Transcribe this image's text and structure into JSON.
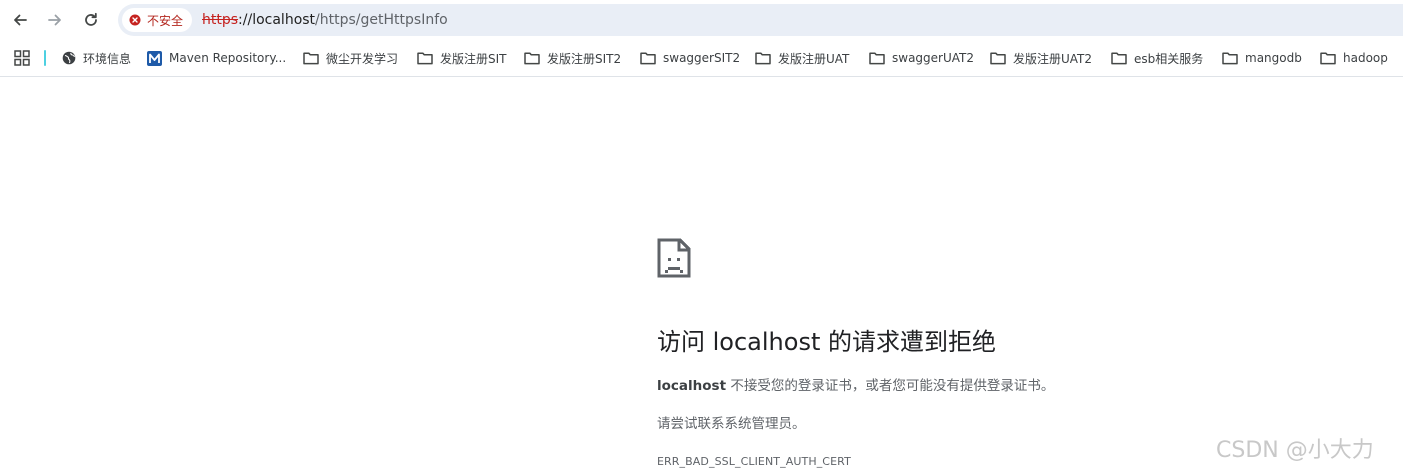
{
  "omnibox": {
    "security_chip": "不安全",
    "url_scheme": "https",
    "url_separator": "://",
    "url_host": "localhost",
    "url_path": "/https/getHttpsInfo"
  },
  "bookmarks": [
    {
      "label": "环境信息",
      "icon": "globe-icon"
    },
    {
      "label": "Maven Repository...",
      "icon": "maven-icon"
    },
    {
      "label": "微尘开发学习",
      "icon": "folder-icon"
    },
    {
      "label": "发版注册SIT",
      "icon": "folder-icon"
    },
    {
      "label": "发版注册SIT2",
      "icon": "folder-icon"
    },
    {
      "label": "swaggerSIT2",
      "icon": "folder-icon"
    },
    {
      "label": "发版注册UAT",
      "icon": "folder-icon"
    },
    {
      "label": "swaggerUAT2",
      "icon": "folder-icon"
    },
    {
      "label": "发版注册UAT2",
      "icon": "folder-icon"
    },
    {
      "label": "esb相关服务",
      "icon": "folder-icon"
    },
    {
      "label": "mangodb",
      "icon": "folder-icon"
    },
    {
      "label": "hadoop",
      "icon": "folder-icon"
    }
  ],
  "error": {
    "heading": "访问 localhost 的请求遭到拒绝",
    "desc_host": "localhost",
    "desc_text": " 不接受您的登录证书，或者您可能没有提供登录证书。",
    "advice": "请尝试联系系统管理员。",
    "code": "ERR_BAD_SSL_CLIENT_AUTH_CERT"
  },
  "watermark": "CSDN @小大力",
  "colors": {
    "omnibox_bg": "#e9eef6",
    "danger": "#c5221f",
    "text_primary": "#202124",
    "text_secondary": "#5f6368"
  }
}
